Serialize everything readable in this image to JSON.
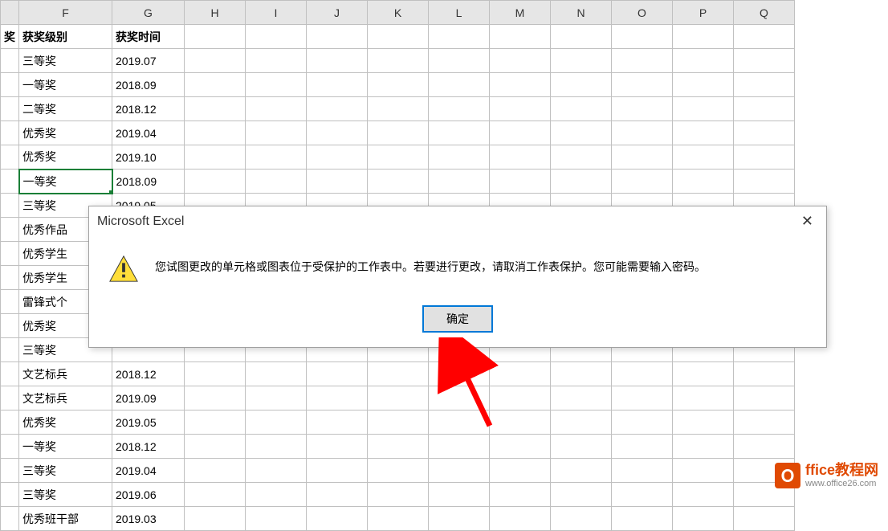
{
  "columns": [
    "F",
    "G",
    "H",
    "I",
    "J",
    "K",
    "L",
    "M",
    "N",
    "O",
    "P",
    "Q"
  ],
  "headerRow": {
    "f": "获奖级别",
    "g": "获奖时间"
  },
  "rows": [
    {
      "f": "三等奖",
      "g": "2019.07"
    },
    {
      "f": "一等奖",
      "g": "2018.09"
    },
    {
      "f": "二等奖",
      "g": "2018.12"
    },
    {
      "f": "优秀奖",
      "g": "2019.04"
    },
    {
      "f": "优秀奖",
      "g": "2019.10"
    },
    {
      "f": "一等奖",
      "g": "2018.09"
    },
    {
      "f": "三等奖",
      "g": "2019.05"
    },
    {
      "f": "优秀作品",
      "g": ""
    },
    {
      "f": "优秀学生",
      "g": ""
    },
    {
      "f": "优秀学生",
      "g": ""
    },
    {
      "f": "雷锋式个",
      "g": ""
    },
    {
      "f": "优秀奖",
      "g": ""
    },
    {
      "f": "三等奖",
      "g": ""
    },
    {
      "f": "文艺标兵",
      "g": "2018.12"
    },
    {
      "f": "文艺标兵",
      "g": "2019.09"
    },
    {
      "f": "优秀奖",
      "g": "2019.05"
    },
    {
      "f": "一等奖",
      "g": "2018.12"
    },
    {
      "f": "三等奖",
      "g": "2019.04"
    },
    {
      "f": "三等奖",
      "g": "2019.06"
    },
    {
      "f": "优秀班干部",
      "g": "2019.03"
    }
  ],
  "selected_cell": "F7",
  "partial_col_header": "奖",
  "dialog": {
    "title": "Microsoft Excel",
    "message": "您试图更改的单元格或图表位于受保护的工作表中。若要进行更改，请取消工作表保护。您可能需要输入密码。",
    "ok": "确定"
  },
  "watermark": {
    "logo_letter": "O",
    "title_en": "ffice",
    "title_cn": "教程网",
    "url": "www.office26.com"
  },
  "icons": {
    "close": "✕"
  }
}
